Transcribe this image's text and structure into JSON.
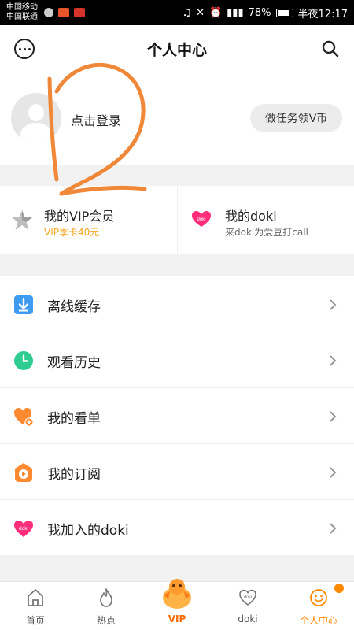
{
  "status_bar": {
    "carrier1": "中国移动",
    "carrier2": "中国联通",
    "battery_pct": "78%",
    "time": "半夜12:17"
  },
  "header": {
    "title": "个人中心"
  },
  "profile": {
    "login_text": "点击登录",
    "task_button": "做任务领V币"
  },
  "cards": {
    "vip": {
      "title": "我的VIP会员",
      "subtitle": "VIP季卡40元"
    },
    "doki": {
      "title": "我的doki",
      "subtitle": "来doki为爱豆打call"
    }
  },
  "menu": [
    {
      "label": "离线缓存",
      "icon": "download-icon"
    },
    {
      "label": "观看历史",
      "icon": "clock-icon"
    },
    {
      "label": "我的看单",
      "icon": "heart-plus-icon"
    },
    {
      "label": "我的订阅",
      "icon": "subscription-icon"
    },
    {
      "label": "我加入的doki",
      "icon": "doki-icon"
    }
  ],
  "tabbar": [
    {
      "label": "首页",
      "icon": "home-icon"
    },
    {
      "label": "热点",
      "icon": "flame-icon"
    },
    {
      "label": "VIP",
      "icon": "vip-mascot-icon"
    },
    {
      "label": "doki",
      "icon": "doki-heart-icon"
    },
    {
      "label": "个人中心",
      "icon": "smiley-icon",
      "active": true
    }
  ],
  "colors": {
    "accent": "#ff8a00",
    "vip_gold": "#f5a623",
    "doki_pink": "#ff2d7a",
    "download_blue": "#3d9bf0",
    "history_green": "#2ecc8f",
    "scribble": "#f0883a"
  }
}
